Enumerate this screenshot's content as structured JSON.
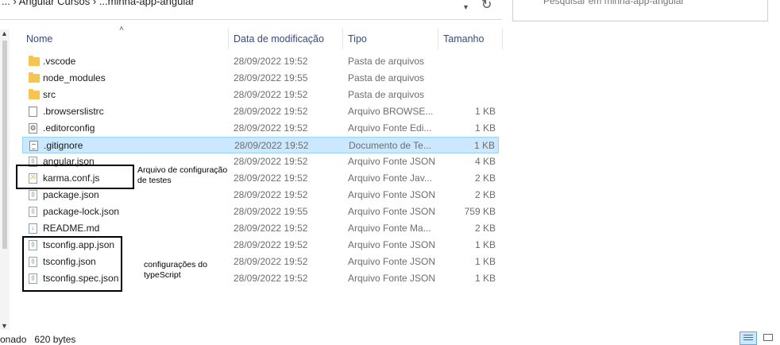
{
  "address_bar": {
    "path": "...  ›  Angular Cursos  ›  ...minha-app-angular",
    "dropdown_icon": "chevron-down-icon",
    "refresh_icon": "refresh-icon"
  },
  "search": {
    "placeholder": "Pesquisar em minha-app-angular",
    "icon": "search-icon"
  },
  "columns": {
    "name": "Nome",
    "date": "Data de modificação",
    "type": "Tipo",
    "size": "Tamanho"
  },
  "files": [
    {
      "name": ".vscode",
      "date": "28/09/2022 19:52",
      "type": "Pasta de arquivos",
      "size": "",
      "icon": "folder-icon"
    },
    {
      "name": "node_modules",
      "date": "28/09/2022 19:55",
      "type": "Pasta de arquivos",
      "size": "",
      "icon": "folder-icon"
    },
    {
      "name": "src",
      "date": "28/09/2022 19:52",
      "type": "Pasta de arquivos",
      "size": "",
      "icon": "folder-icon"
    },
    {
      "name": ".browserslistrc",
      "date": "28/09/2022 19:52",
      "type": "Arquivo BROWSE...",
      "size": "1 KB",
      "icon": "file-icon"
    },
    {
      "name": ".editorconfig",
      "date": "28/09/2022 19:52",
      "type": "Arquivo Fonte Edi...",
      "size": "1 KB",
      "icon": "config-file-icon"
    },
    {
      "name": ".gitignore",
      "date": "28/09/2022 19:52",
      "type": "Documento de Te...",
      "size": "1 KB",
      "icon": "text-document-icon",
      "selected": true
    },
    {
      "name": "angular.json",
      "date": "28/09/2022 19:52",
      "type": "Arquivo Fonte JSON",
      "size": "4 KB",
      "icon": "json-file-icon"
    },
    {
      "name": "karma.conf.js",
      "date": "28/09/2022 19:52",
      "type": "Arquivo Fonte Jav...",
      "size": "2 KB",
      "icon": "js-file-icon"
    },
    {
      "name": "package.json",
      "date": "28/09/2022 19:52",
      "type": "Arquivo Fonte JSON",
      "size": "2 KB",
      "icon": "json-file-icon"
    },
    {
      "name": "package-lock.json",
      "date": "28/09/2022 19:55",
      "type": "Arquivo Fonte JSON",
      "size": "759 KB",
      "icon": "json-file-icon"
    },
    {
      "name": "README.md",
      "date": "28/09/2022 19:52",
      "type": "Arquivo Fonte Ma...",
      "size": "2 KB",
      "icon": "markdown-file-icon"
    },
    {
      "name": "tsconfig.app.json",
      "date": "28/09/2022 19:52",
      "type": "Arquivo Fonte JSON",
      "size": "1 KB",
      "icon": "json-file-icon"
    },
    {
      "name": "tsconfig.json",
      "date": "28/09/2022 19:52",
      "type": "Arquivo Fonte JSON",
      "size": "1 KB",
      "icon": "json-file-icon"
    },
    {
      "name": "tsconfig.spec.json",
      "date": "28/09/2022 19:52",
      "type": "Arquivo Fonte JSON",
      "size": "1 KB",
      "icon": "json-file-icon"
    }
  ],
  "annotations": {
    "karma_note": "Arquivo de configuração\nde testes",
    "tsconfig_note": "configurações do\ntypeScript"
  },
  "status_bar": {
    "selection": "onado",
    "size": "620 bytes"
  },
  "colors": {
    "selection": "#cce8ff",
    "selection_border": "#99d1ff",
    "header_text": "#3a4a7a",
    "folder": "#f5c451"
  }
}
